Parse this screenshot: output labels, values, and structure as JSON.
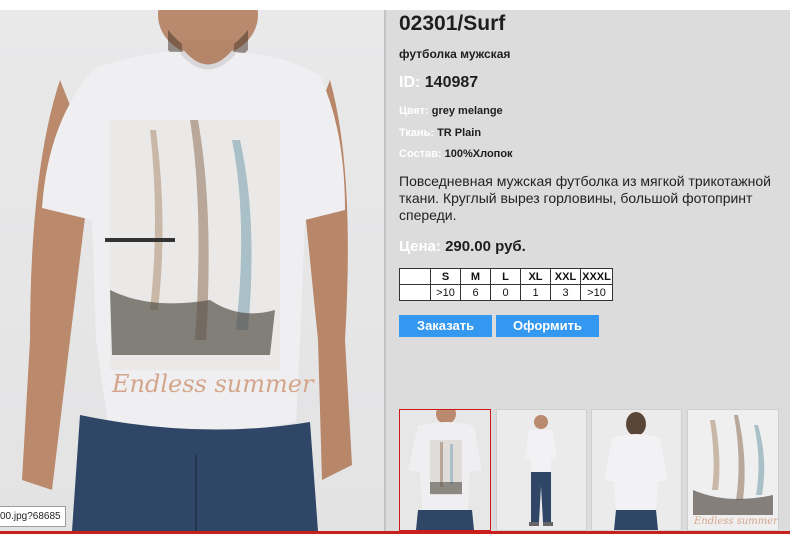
{
  "product": {
    "title": "02301/Surf",
    "subtitle": "футболка мужская",
    "id_label": "ID:",
    "id_value": "140987",
    "color_label": "Цвет:",
    "color_value": "grey melange",
    "fabric_label": "Ткань:",
    "fabric_value": "TR Plain",
    "composition_label": "Состав:",
    "composition_value": "100%Хлопок",
    "description": "Повседневная мужская футболка из мягкой трикотажной ткани. Круглый вырез горловины, большой фотопринт спереди.",
    "price_label": "Цена:",
    "price_value": "290.00 руб."
  },
  "sizes": {
    "headers": [
      "",
      "S",
      "M",
      "L",
      "XL",
      "XXL",
      "XXXL"
    ],
    "stock": [
      "",
      ">10",
      "6",
      "0",
      "1",
      "3",
      ">10"
    ]
  },
  "buttons": {
    "order": "Заказать",
    "checkout": "Оформить"
  },
  "main_image": {
    "print_text": "Endless summer"
  },
  "thumbnails": [
    {
      "label": "thumbnail-front",
      "selected": true
    },
    {
      "label": "thumbnail-full-body"
    },
    {
      "label": "thumbnail-back"
    },
    {
      "label": "thumbnail-print-closeup"
    }
  ],
  "status_tooltip": "00.jpg?68685",
  "colors": {
    "button_bg": "#3497f0",
    "selected_thumb_border": "#d01818",
    "background": "#dcdcdc",
    "bottom_line": "#c8201c"
  }
}
